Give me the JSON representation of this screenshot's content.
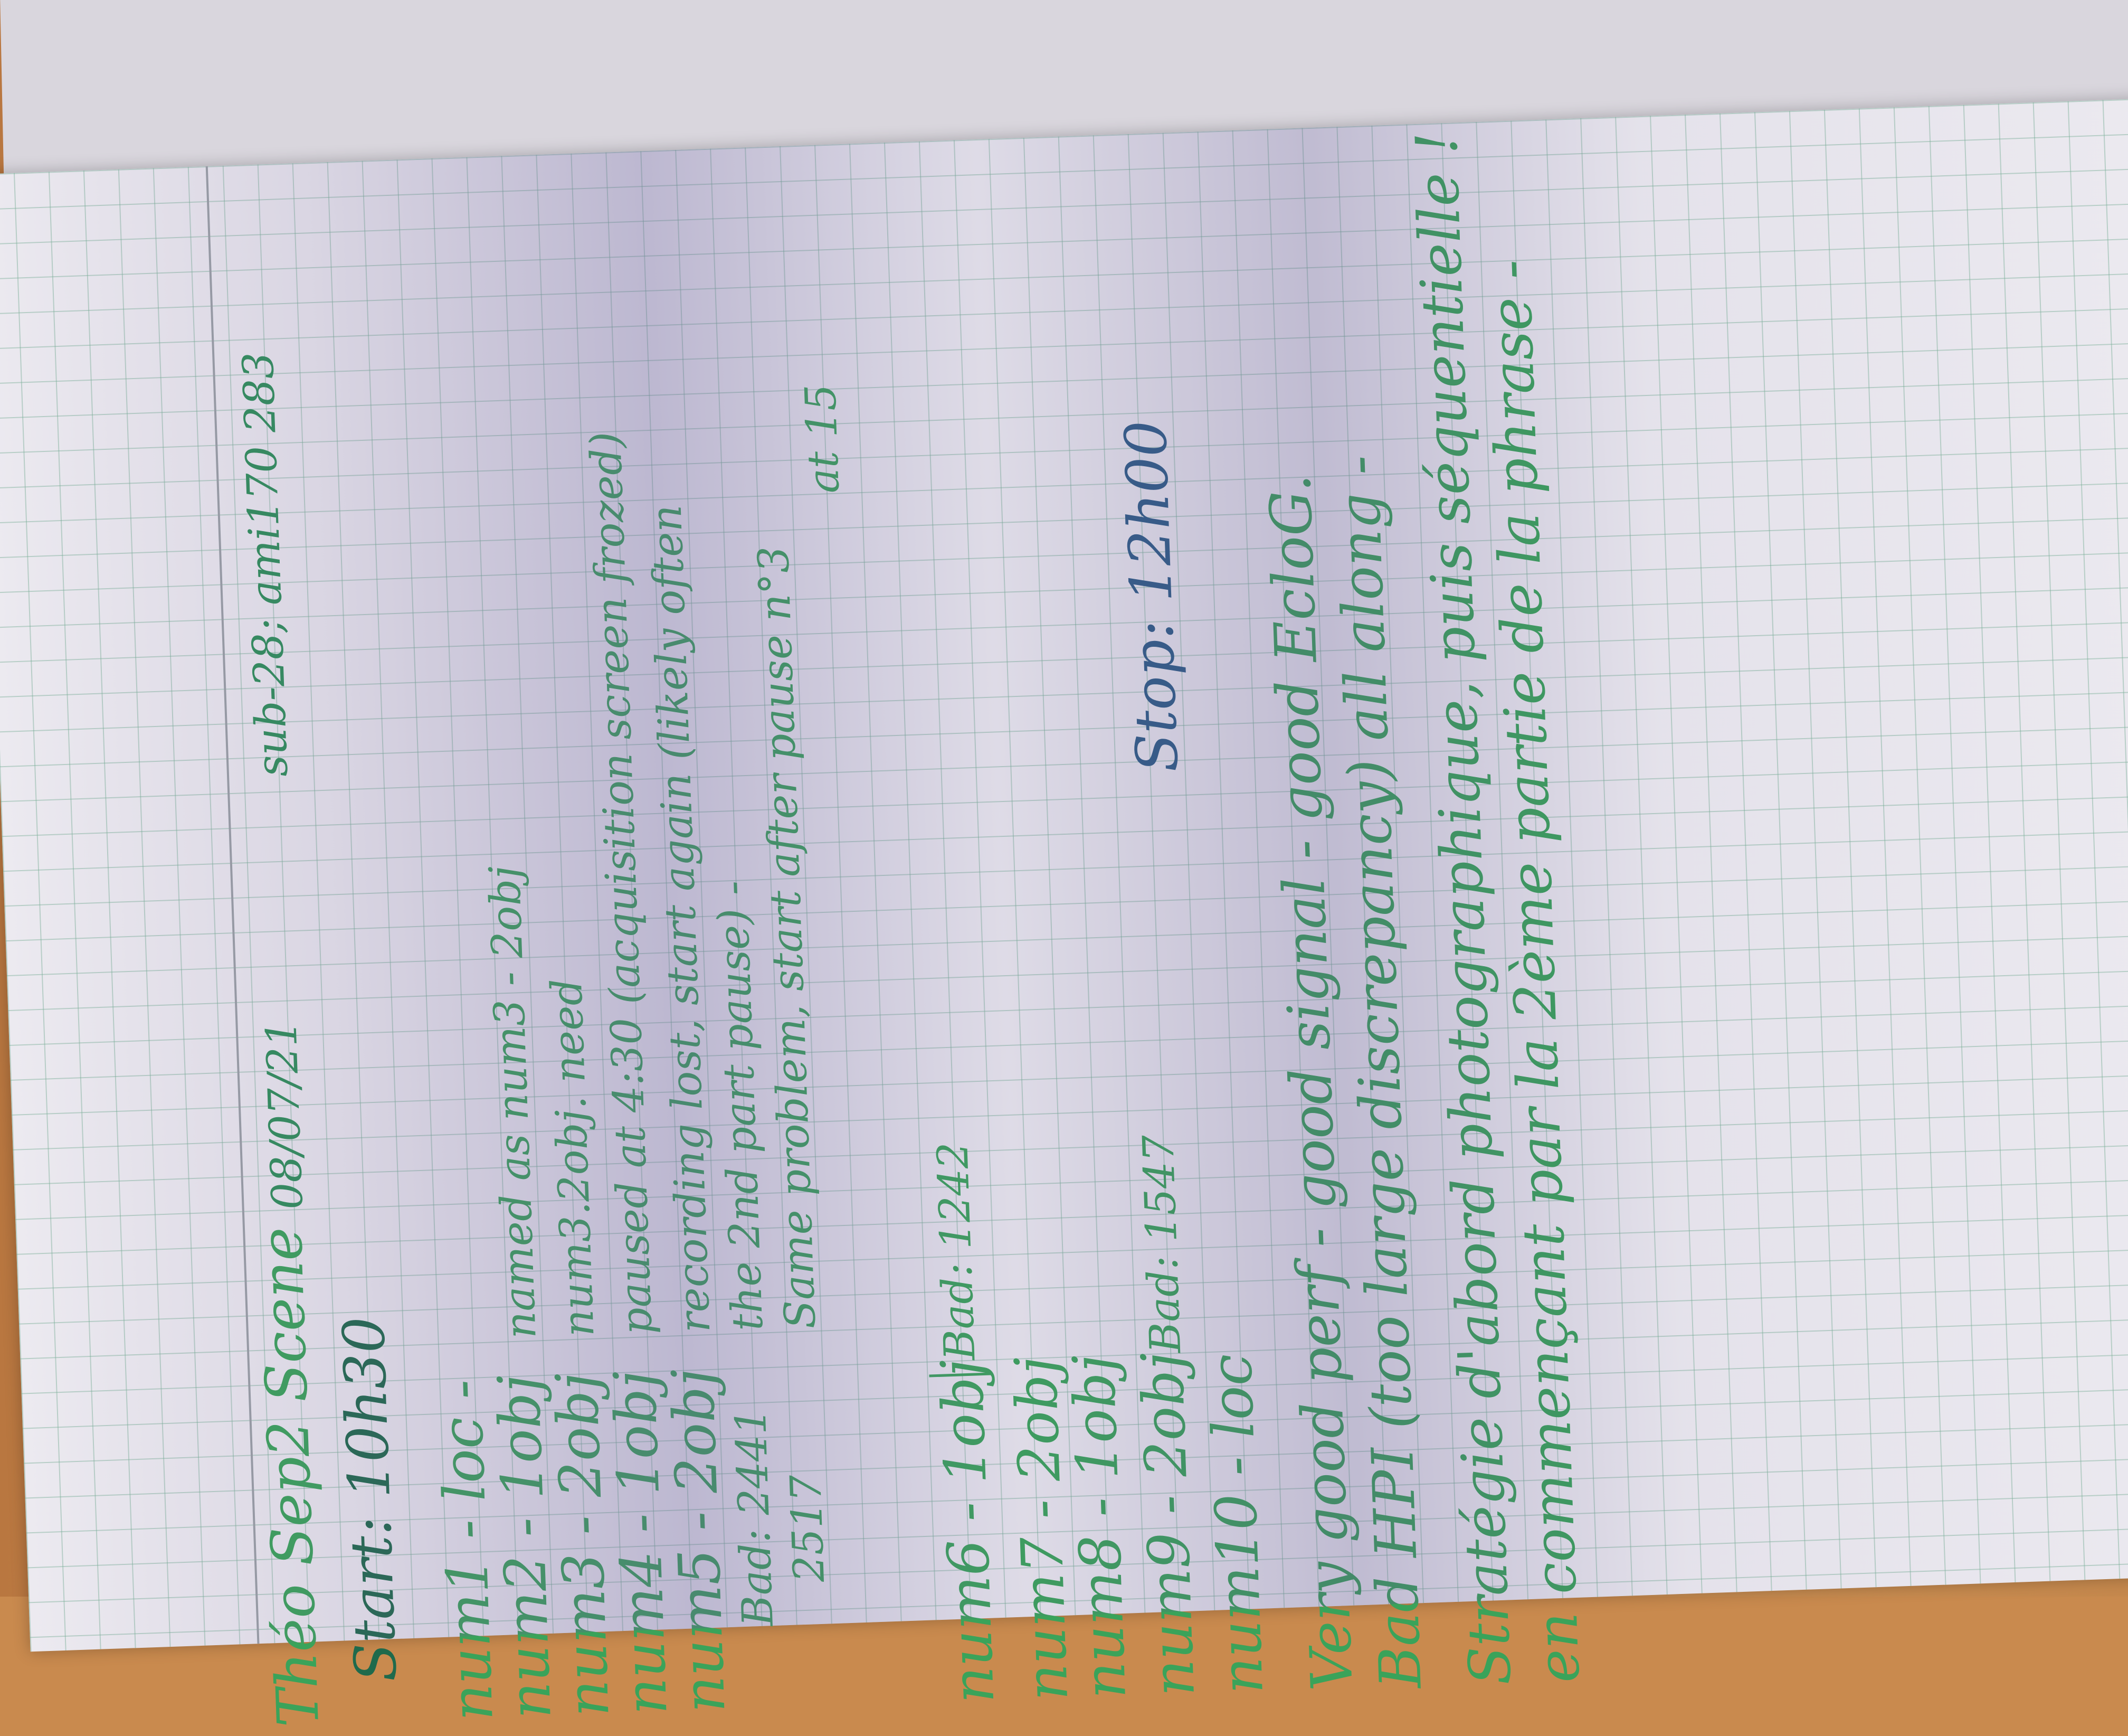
{
  "header": {
    "title": "Théo Sep2 Scene",
    "date": "08/07/21",
    "subject": "sub-28; ami170 283"
  },
  "start": "Start: 10h30",
  "entries": [
    {
      "text": "num1 - loc -"
    },
    {
      "text": "num2 - 1obj",
      "note": "named as num3 - 2obj"
    },
    {
      "text": "num3 - 2obj",
      "note": "num3.2obj. need"
    },
    {
      "text": "num4 - 1obj",
      "note": "paused at 4:30 (acquisition screen frozed)"
    },
    {
      "text": "num5 - 2obj",
      "note": "recording lost, start again (likely often"
    },
    {
      "text": "Bad: 2441",
      "note": "the 2nd part pause) -"
    },
    {
      "text": "2517",
      "note": "Same problem, start after pause n°3"
    },
    {
      "text": "",
      "note": "at 15"
    },
    {
      "text": "num6 - 1obj",
      "bad": "Bad: 1242"
    },
    {
      "text": "num7 - 2obj"
    },
    {
      "text": "num8 - 1obj"
    },
    {
      "text": "num9 - 2obj",
      "bad": "Bad: 1547"
    },
    {
      "text": "num10 - loc"
    }
  ],
  "stop": "Stop: 12h00",
  "notes": [
    "Very good perf - good signal - good EcloG.",
    "Bad HPI (too large discrepancy) all along -",
    "Stratégie d'abord photographique, puis séquentielle !",
    "en commençant par la 2ème partie de la phrase -"
  ]
}
